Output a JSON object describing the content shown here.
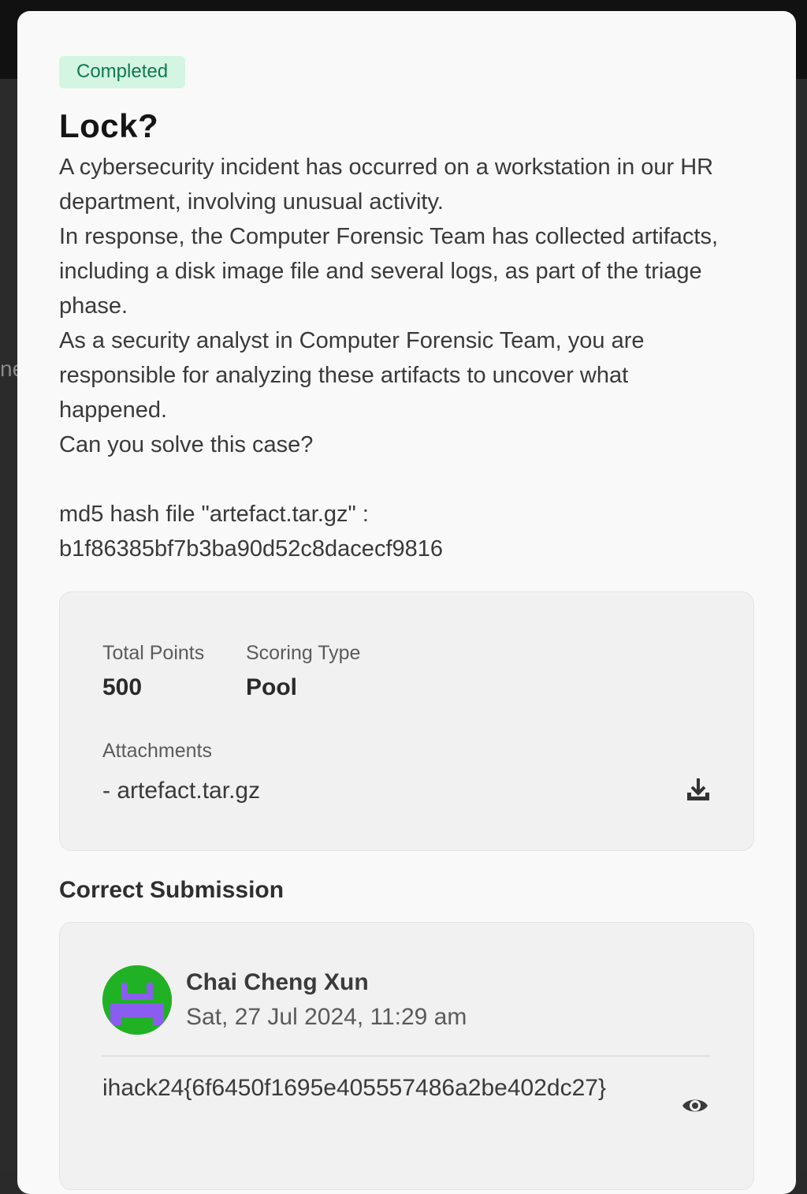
{
  "status_badge": "Completed",
  "challenge": {
    "title": "Lock?",
    "description": [
      "A cybersecurity incident has occurred on a workstation in our HR department, involving unusual activity.",
      "In response, the Computer Forensic Team has collected artifacts, including a disk image file and several logs, as part of the triage phase.",
      "As a security analyst in Computer Forensic Team, you are responsible for analyzing these artifacts to uncover what happened.",
      "Can you solve this case?"
    ],
    "hash_line_1": "md5 hash file \"artefact.tar.gz\" :",
    "hash_line_2": "b1f86385bf7b3ba90d52c8dacecf9816"
  },
  "info": {
    "total_points_label": "Total Points",
    "total_points_value": "500",
    "scoring_type_label": "Scoring Type",
    "scoring_type_value": "Pool",
    "attachments_label": "Attachments",
    "attachment_file": "- artefact.tar.gz"
  },
  "submission": {
    "section_title": "Correct Submission",
    "user_name": "Chai Cheng Xun",
    "timestamp": "Sat, 27 Jul 2024, 11:29 am",
    "flag": "ihack24{6f6450f1695e405557486a2be402dc27}"
  },
  "colors": {
    "badge_bg": "#d3f5e2",
    "badge_text": "#127a4a",
    "avatar_bg": "#20b224",
    "avatar_glyph": "#8a5cf0"
  },
  "icons": {
    "download": "download-icon",
    "reveal": "eye-icon"
  }
}
